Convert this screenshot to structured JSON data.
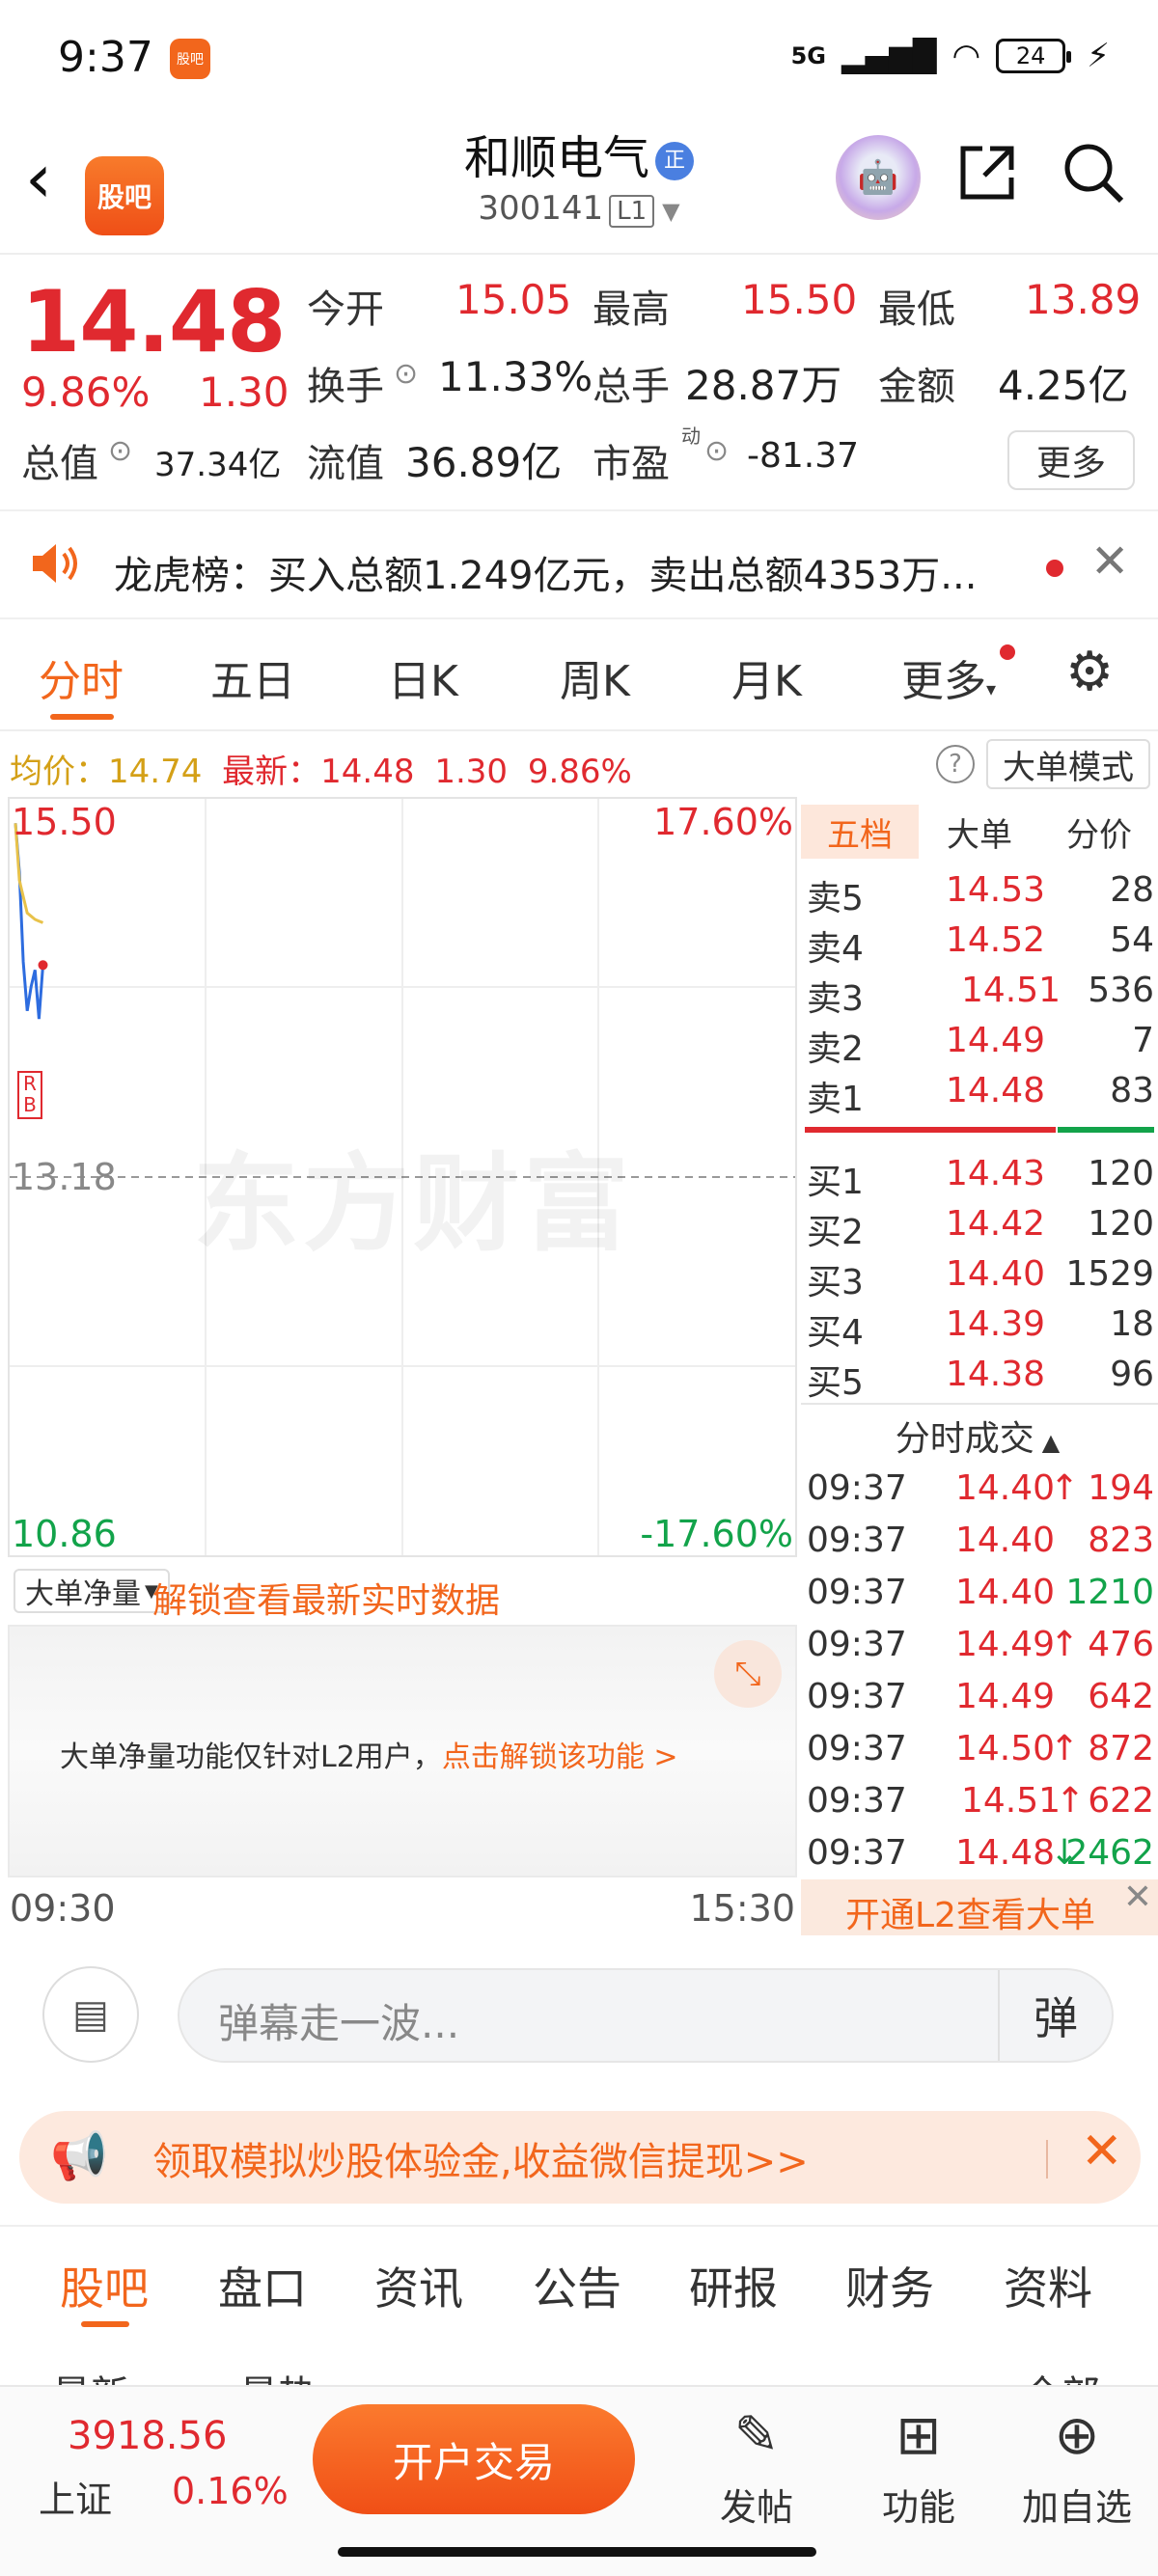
{
  "status_bar": {
    "time": "9:37",
    "app_badge": "股吧",
    "network": "5G",
    "battery": "24"
  },
  "header": {
    "logo": "股吧",
    "title": "和顺电气",
    "title_tag": "正",
    "code": "300141",
    "level": "L1"
  },
  "quote": {
    "price": "14.48",
    "pct": "9.86%",
    "change": "1.30",
    "open_label": "今开",
    "open": "15.05",
    "high_label": "最高",
    "high": "15.50",
    "low_label": "最低",
    "low": "13.89",
    "turnover_label": "换手",
    "turnover": "11.33%",
    "volume_label": "总手",
    "volume": "28.87万",
    "amount_label": "金额",
    "amount": "4.25亿",
    "mktcap_label": "总值",
    "mktcap": "37.34亿",
    "float_label": "流值",
    "float": "36.89亿",
    "pe_label": "市盈",
    "pe_sup": "动",
    "pe": "-81.37",
    "more": "更多"
  },
  "notice": {
    "text": "龙虎榜：买入总额1.249亿元，卖出总额4353万..."
  },
  "tabs": [
    "分时",
    "五日",
    "日K",
    "周K",
    "月K",
    "更多"
  ],
  "infoline": {
    "avg_label": "均价：",
    "avg": "14.74",
    "latest_label": "最新：",
    "latest": "14.48",
    "chg": "1.30",
    "pct": "9.86%",
    "mode": "大单模式"
  },
  "chart_labels": {
    "top_price": "15.50",
    "top_pct": "17.60%",
    "mid_price": "13.18",
    "bottom_price": "10.86",
    "bottom_pct": "-17.60%",
    "watermark": "东方财富",
    "marker_r": "R",
    "marker_b": "B",
    "time_start": "09:30",
    "time_end": "15:30"
  },
  "chart_data": {
    "type": "line",
    "ylim": [
      10.86,
      15.5
    ],
    "x": [
      "09:30",
      "09:31",
      "09:32",
      "09:33",
      "09:34",
      "09:35",
      "09:36",
      "09:37"
    ],
    "series": [
      {
        "values": [
          15.35,
          15.05,
          14.5,
          14.2,
          14.35,
          14.45,
          14.15,
          14.48
        ]
      },
      {
        "values": [
          15.35,
          15.0,
          14.9,
          14.8,
          14.78,
          14.76,
          14.75,
          14.74
        ]
      }
    ]
  },
  "book": {
    "tabs": [
      "五档",
      "大单",
      "分价"
    ],
    "asks": [
      {
        "label": "卖5",
        "price": "14.53",
        "vol": "28"
      },
      {
        "label": "卖4",
        "price": "14.52",
        "vol": "54"
      },
      {
        "label": "卖3",
        "price": "14.51",
        "vol": "536"
      },
      {
        "label": "卖2",
        "price": "14.49",
        "vol": "7"
      },
      {
        "label": "卖1",
        "price": "14.48",
        "vol": "83"
      }
    ],
    "bids": [
      {
        "label": "买1",
        "price": "14.43",
        "vol": "120"
      },
      {
        "label": "买2",
        "price": "14.42",
        "vol": "120"
      },
      {
        "label": "买3",
        "price": "14.40",
        "vol": "1529"
      },
      {
        "label": "买4",
        "price": "14.39",
        "vol": "18"
      },
      {
        "label": "买5",
        "price": "14.38",
        "vol": "96"
      }
    ],
    "ticks_title": "分时成交",
    "ticks": [
      {
        "time": "09:37",
        "price": "14.40",
        "arrow": "↑",
        "vol": "194",
        "dir": "up"
      },
      {
        "time": "09:37",
        "price": "14.40",
        "arrow": "",
        "vol": "823",
        "dir": "up"
      },
      {
        "time": "09:37",
        "price": "14.40",
        "arrow": "",
        "vol": "1210",
        "dir": "down"
      },
      {
        "time": "09:37",
        "price": "14.49",
        "arrow": "↑",
        "vol": "476",
        "dir": "up"
      },
      {
        "time": "09:37",
        "price": "14.49",
        "arrow": "",
        "vol": "642",
        "dir": "up"
      },
      {
        "time": "09:37",
        "price": "14.50",
        "arrow": "↑",
        "vol": "872",
        "dir": "up"
      },
      {
        "time": "09:37",
        "price": "14.51",
        "arrow": "↑",
        "vol": "622",
        "dir": "up"
      },
      {
        "time": "09:37",
        "price": "14.48",
        "arrow": "↓",
        "vol": "2462",
        "dir": "down"
      }
    ],
    "l2_text": "开通L2查看大单"
  },
  "netflow": {
    "select": "大单净量",
    "unlock": "解锁查看最新实时数据",
    "message": "大单净量功能仅针对L2用户，",
    "message_link": "点击解锁该功能 >"
  },
  "comment": {
    "placeholder": "弹幕走一波...",
    "dan": "弹"
  },
  "promo": {
    "text": "领取模拟炒股体验金,收益微信提现>>"
  },
  "sections": [
    "股吧",
    "盘口",
    "资讯",
    "公告",
    "研报",
    "财务",
    "资料"
  ],
  "subtabs": [
    "最新",
    "最热",
    "全部"
  ],
  "bottom": {
    "index_value": "3918.56",
    "index_name": "上证",
    "index_pct": "0.16%",
    "trade": "开户交易",
    "post": "发帖",
    "func": "功能",
    "add": "加自选"
  },
  "colors": {
    "accent": "#f2661c",
    "up": "#e0292f",
    "down": "#12a34a"
  }
}
